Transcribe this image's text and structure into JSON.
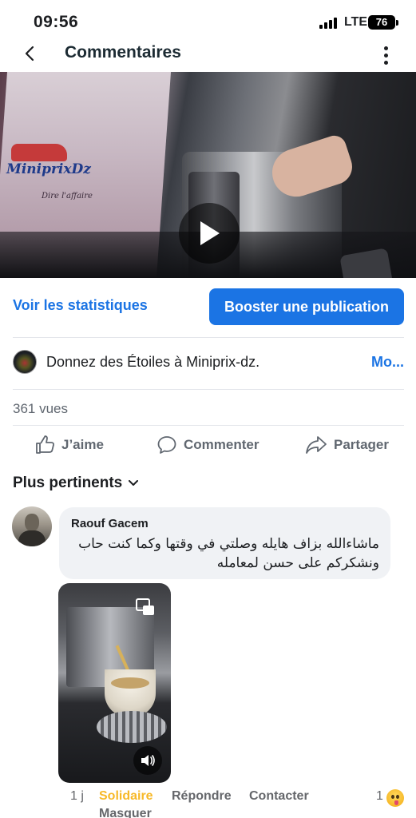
{
  "status_bar": {
    "time": "09:56",
    "network": "LTE",
    "battery": "76"
  },
  "header": {
    "title": "Commentaires",
    "back_icon": "chevron-left-icon",
    "more_icon": "kebab-menu-icon"
  },
  "video": {
    "play_icon": "play-icon",
    "brand_text": "MiniprixDz",
    "brand_tagline": "Dire l'affaire"
  },
  "actions": {
    "stats_link": "Voir les statistiques",
    "boost_button": "Booster une publication"
  },
  "stars_promo": {
    "text": "Donnez des Étoiles à Miniprix-dz.",
    "more": "Mo..."
  },
  "views": "361 vues",
  "reactions": {
    "like": "J’aime",
    "comment": "Commenter",
    "share": "Partager"
  },
  "comments": {
    "sort_label": "Plus pertinents",
    "items": [
      {
        "author": "Raouf Gacem",
        "text": "ماشاءالله بزاف هايله وصلتي في وقتها وكما كنت حاب ونشكركم على حسن لمعامله",
        "time": "1 j",
        "actions": [
          "Solidaire",
          "Répondre",
          "Contacter",
          "Masquer"
        ],
        "reaction_count": "1"
      }
    ]
  },
  "colors": {
    "accent": "#1b74e4",
    "solidaire": "#f7b928",
    "muted": "#65676b"
  }
}
